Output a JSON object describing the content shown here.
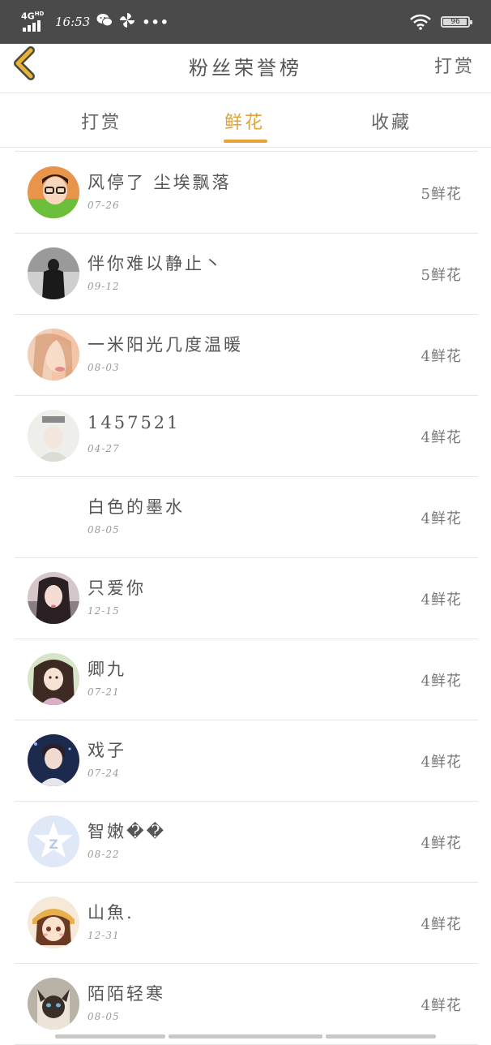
{
  "status_bar": {
    "network": "4G",
    "network_sup": "HD",
    "time": "16:53",
    "battery": "96",
    "battery_level": 0.96
  },
  "header": {
    "title": "粉丝荣誉榜",
    "right_action": "打赏"
  },
  "tabs": [
    {
      "label": "打赏",
      "active": false
    },
    {
      "label": "鲜花",
      "active": true
    },
    {
      "label": "收藏",
      "active": false
    }
  ],
  "colors": {
    "accent": "#e8a235",
    "back_icon": "#e9b23b",
    "status_bar_bg": "#4a4a4a"
  },
  "fans": [
    {
      "name": "风停了 尘埃飘落",
      "date": "07-26",
      "amount": "5鲜花",
      "avatar": "photo-boy-glasses"
    },
    {
      "name": "伴你难以静止丶",
      "date": "09-12",
      "amount": "5鲜花",
      "avatar": "photo-dark-figure"
    },
    {
      "name": "一米阳光几度温暖",
      "date": "08-03",
      "amount": "4鲜花",
      "avatar": "photo-girl-pink"
    },
    {
      "name": "1457521",
      "date": "04-27",
      "amount": "4鲜花",
      "avatar": "photo-light"
    },
    {
      "name": "白色的墨水",
      "date": "08-05",
      "amount": "4鲜花",
      "avatar": "none"
    },
    {
      "name": "只爱你",
      "date": "12-15",
      "amount": "4鲜花",
      "avatar": "photo-girl-dark"
    },
    {
      "name": "卿九",
      "date": "07-21",
      "amount": "4鲜花",
      "avatar": "photo-anime-girl"
    },
    {
      "name": "戏子",
      "date": "07-24",
      "amount": "4鲜花",
      "avatar": "photo-boy-blue"
    },
    {
      "name": "智嫩��",
      "date": "08-22",
      "amount": "4鲜花",
      "avatar": "qzone-star-icon"
    },
    {
      "name": "山魚.",
      "date": "12-31",
      "amount": "4鲜花",
      "avatar": "photo-cartoon-girl"
    },
    {
      "name": "陌陌轻寒",
      "date": "08-05",
      "amount": "4鲜花",
      "avatar": "photo-cat"
    }
  ]
}
